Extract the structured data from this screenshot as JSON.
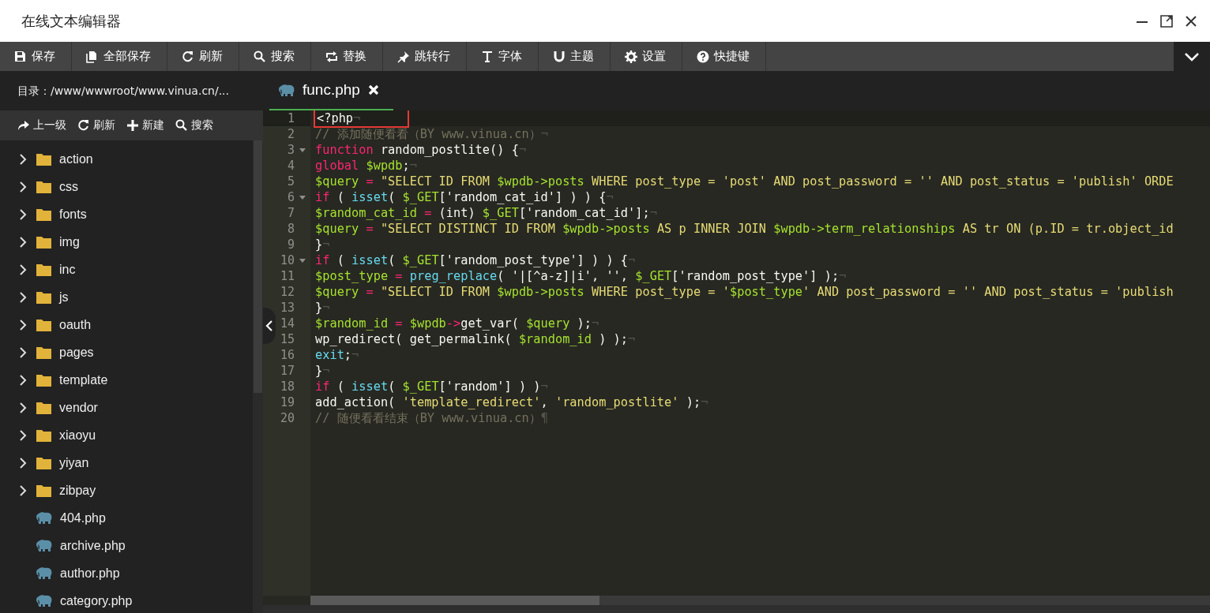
{
  "window": {
    "title": "在线文本编辑器"
  },
  "toolbar": [
    {
      "label": "保存"
    },
    {
      "label": "全部保存"
    },
    {
      "label": "刷新"
    },
    {
      "label": "搜索"
    },
    {
      "label": "替换"
    },
    {
      "label": "跳转行"
    },
    {
      "label": "字体"
    },
    {
      "label": "主题"
    },
    {
      "label": "设置"
    },
    {
      "label": "快捷键"
    }
  ],
  "sidebar": {
    "path": "目录：/www/wwwroot/www.vinua.cn/...",
    "actions": [
      {
        "label": "上一级"
      },
      {
        "label": "刷新"
      },
      {
        "label": "新建"
      },
      {
        "label": "搜索"
      }
    ],
    "items": [
      {
        "kind": "folder",
        "name": "action",
        "expanded": false
      },
      {
        "kind": "folder",
        "name": "css",
        "expanded": false
      },
      {
        "kind": "folder",
        "name": "fonts",
        "expanded": false
      },
      {
        "kind": "folder",
        "name": "img",
        "expanded": false
      },
      {
        "kind": "folder",
        "name": "inc",
        "expanded": false
      },
      {
        "kind": "folder",
        "name": "js",
        "expanded": false
      },
      {
        "kind": "folder",
        "name": "oauth",
        "expanded": false
      },
      {
        "kind": "folder",
        "name": "pages",
        "expanded": false
      },
      {
        "kind": "folder",
        "name": "template",
        "expanded": false
      },
      {
        "kind": "folder",
        "name": "vendor",
        "expanded": false
      },
      {
        "kind": "folder",
        "name": "xiaoyu",
        "expanded": false
      },
      {
        "kind": "folder",
        "name": "yiyan",
        "expanded": false
      },
      {
        "kind": "folder",
        "name": "zibpay",
        "expanded": false
      },
      {
        "kind": "file",
        "name": "404.php"
      },
      {
        "kind": "file",
        "name": "archive.php"
      },
      {
        "kind": "file",
        "name": "author.php"
      },
      {
        "kind": "file",
        "name": "category.php"
      }
    ]
  },
  "editor": {
    "tabs": [
      {
        "name": "func.php",
        "selected": true
      }
    ],
    "lines": [
      {
        "number": "1",
        "fold": false,
        "active": true,
        "boxed": true,
        "tokens": [
          {
            "kind": "plain",
            "text": "<?php"
          },
          {
            "kind": "ws",
            "text": "¬"
          }
        ]
      },
      {
        "number": "2",
        "fold": false,
        "active": false,
        "boxed": false,
        "tokens": [
          {
            "kind": "comment",
            "text": "// 添加随便看看（BY www.vinua.cn）"
          },
          {
            "kind": "ws",
            "text": "¬"
          }
        ]
      },
      {
        "number": "3",
        "fold": true,
        "active": false,
        "boxed": false,
        "tokens": [
          {
            "kind": "kw",
            "text": "function"
          },
          {
            "kind": "plain",
            "text": " random_postlite() {"
          },
          {
            "kind": "ws",
            "text": "¬"
          }
        ]
      },
      {
        "number": "4",
        "fold": false,
        "active": false,
        "boxed": false,
        "tokens": [
          {
            "kind": "kw",
            "text": "global "
          },
          {
            "kind": "var",
            "text": "$wpdb"
          },
          {
            "kind": "plain",
            "text": ";"
          },
          {
            "kind": "ws",
            "text": "¬"
          }
        ]
      },
      {
        "number": "5",
        "fold": false,
        "active": false,
        "boxed": false,
        "tokens": [
          {
            "kind": "var",
            "text": "$query"
          },
          {
            "kind": "kw",
            "text": " = "
          },
          {
            "kind": "str",
            "text": "\"SELECT ID FROM "
          },
          {
            "kind": "var",
            "text": "$wpdb->posts"
          },
          {
            "kind": "str",
            "text": " WHERE post_type = 'post' AND post_password = '' AND post_status = 'publish' ORDE"
          }
        ]
      },
      {
        "number": "6",
        "fold": true,
        "active": false,
        "boxed": false,
        "tokens": [
          {
            "kind": "kw",
            "text": "if"
          },
          {
            "kind": "plain",
            "text": " ( "
          },
          {
            "kind": "fn",
            "text": "isset"
          },
          {
            "kind": "plain",
            "text": "( "
          },
          {
            "kind": "var",
            "text": "$_GET"
          },
          {
            "kind": "plain",
            "text": "['random_cat_id'] ) ) {"
          },
          {
            "kind": "ws",
            "text": "¬"
          }
        ]
      },
      {
        "number": "7",
        "fold": false,
        "active": false,
        "boxed": false,
        "tokens": [
          {
            "kind": "var",
            "text": "$random_cat_id"
          },
          {
            "kind": "kw",
            "text": " = "
          },
          {
            "kind": "plain",
            "text": "(int) "
          },
          {
            "kind": "var",
            "text": "$_GET"
          },
          {
            "kind": "plain",
            "text": "['random_cat_id'];"
          },
          {
            "kind": "ws",
            "text": "¬"
          }
        ]
      },
      {
        "number": "8",
        "fold": false,
        "active": false,
        "boxed": false,
        "tokens": [
          {
            "kind": "var",
            "text": "$query"
          },
          {
            "kind": "kw",
            "text": " = "
          },
          {
            "kind": "str",
            "text": "\"SELECT DISTINCT ID FROM "
          },
          {
            "kind": "var",
            "text": "$wpdb->posts"
          },
          {
            "kind": "str",
            "text": " AS p INNER JOIN "
          },
          {
            "kind": "var",
            "text": "$wpdb->term_relationships"
          },
          {
            "kind": "str",
            "text": " AS tr ON (p.ID = tr.object_id"
          }
        ]
      },
      {
        "number": "9",
        "fold": false,
        "active": false,
        "boxed": false,
        "tokens": [
          {
            "kind": "plain",
            "text": "}"
          },
          {
            "kind": "ws",
            "text": "¬"
          }
        ]
      },
      {
        "number": "10",
        "fold": true,
        "active": false,
        "boxed": false,
        "tokens": [
          {
            "kind": "kw",
            "text": "if"
          },
          {
            "kind": "plain",
            "text": " ( "
          },
          {
            "kind": "fn",
            "text": "isset"
          },
          {
            "kind": "plain",
            "text": "( "
          },
          {
            "kind": "var",
            "text": "$_GET"
          },
          {
            "kind": "plain",
            "text": "['random_post_type'] ) ) {"
          },
          {
            "kind": "ws",
            "text": "¬"
          }
        ]
      },
      {
        "number": "11",
        "fold": false,
        "active": false,
        "boxed": false,
        "tokens": [
          {
            "kind": "var",
            "text": "$post_type"
          },
          {
            "kind": "kw",
            "text": " = "
          },
          {
            "kind": "fn",
            "text": "preg_replace"
          },
          {
            "kind": "plain",
            "text": "( '|[^a-z]|i', '', "
          },
          {
            "kind": "var",
            "text": "$_GET"
          },
          {
            "kind": "plain",
            "text": "['random_post_type'] );"
          },
          {
            "kind": "ws",
            "text": "¬"
          }
        ]
      },
      {
        "number": "12",
        "fold": false,
        "active": false,
        "boxed": false,
        "tokens": [
          {
            "kind": "var",
            "text": "$query"
          },
          {
            "kind": "kw",
            "text": " = "
          },
          {
            "kind": "str",
            "text": "\"SELECT ID FROM "
          },
          {
            "kind": "var",
            "text": "$wpdb->posts"
          },
          {
            "kind": "str",
            "text": " WHERE post_type = '"
          },
          {
            "kind": "var",
            "text": "$post_type"
          },
          {
            "kind": "str",
            "text": "' AND post_password = '' AND post_status = 'publish"
          }
        ]
      },
      {
        "number": "13",
        "fold": false,
        "active": false,
        "boxed": false,
        "tokens": [
          {
            "kind": "plain",
            "text": "}"
          },
          {
            "kind": "ws",
            "text": "¬"
          }
        ]
      },
      {
        "number": "14",
        "fold": false,
        "active": false,
        "boxed": false,
        "tokens": [
          {
            "kind": "var",
            "text": "$random_id"
          },
          {
            "kind": "kw",
            "text": " = "
          },
          {
            "kind": "var",
            "text": "$wpdb"
          },
          {
            "kind": "kw",
            "text": "->"
          },
          {
            "kind": "plain",
            "text": "get_var( "
          },
          {
            "kind": "var",
            "text": "$query"
          },
          {
            "kind": "plain",
            "text": " );"
          },
          {
            "kind": "ws",
            "text": "¬"
          }
        ]
      },
      {
        "number": "15",
        "fold": false,
        "active": false,
        "boxed": false,
        "tokens": [
          {
            "kind": "plain",
            "text": "wp_redirect( get_permalink( "
          },
          {
            "kind": "var",
            "text": "$random_id"
          },
          {
            "kind": "plain",
            "text": " ) );"
          },
          {
            "kind": "ws",
            "text": "¬"
          }
        ]
      },
      {
        "number": "16",
        "fold": false,
        "active": false,
        "boxed": false,
        "tokens": [
          {
            "kind": "fn",
            "text": "exit"
          },
          {
            "kind": "plain",
            "text": ";"
          },
          {
            "kind": "ws",
            "text": "¬"
          }
        ]
      },
      {
        "number": "17",
        "fold": false,
        "active": false,
        "boxed": false,
        "tokens": [
          {
            "kind": "plain",
            "text": "}"
          },
          {
            "kind": "ws",
            "text": "¬"
          }
        ]
      },
      {
        "number": "18",
        "fold": false,
        "active": false,
        "boxed": false,
        "tokens": [
          {
            "kind": "kw",
            "text": "if"
          },
          {
            "kind": "plain",
            "text": " ( "
          },
          {
            "kind": "fn",
            "text": "isset"
          },
          {
            "kind": "plain",
            "text": "( "
          },
          {
            "kind": "var",
            "text": "$_GET"
          },
          {
            "kind": "plain",
            "text": "['random'] ) )"
          },
          {
            "kind": "ws",
            "text": "¬"
          }
        ]
      },
      {
        "number": "19",
        "fold": false,
        "active": false,
        "boxed": false,
        "tokens": [
          {
            "kind": "plain",
            "text": "add_action( "
          },
          {
            "kind": "str",
            "text": "'template_redirect'"
          },
          {
            "kind": "plain",
            "text": ", "
          },
          {
            "kind": "str",
            "text": "'random_postlite'"
          },
          {
            "kind": "plain",
            "text": " );"
          },
          {
            "kind": "ws",
            "text": "¬"
          }
        ]
      },
      {
        "number": "20",
        "fold": false,
        "active": false,
        "boxed": false,
        "tokens": [
          {
            "kind": "comment",
            "text": "// 随便看看结束（BY www.vinua.cn）"
          },
          {
            "kind": "ws",
            "text": "¶"
          }
        ]
      }
    ]
  }
}
